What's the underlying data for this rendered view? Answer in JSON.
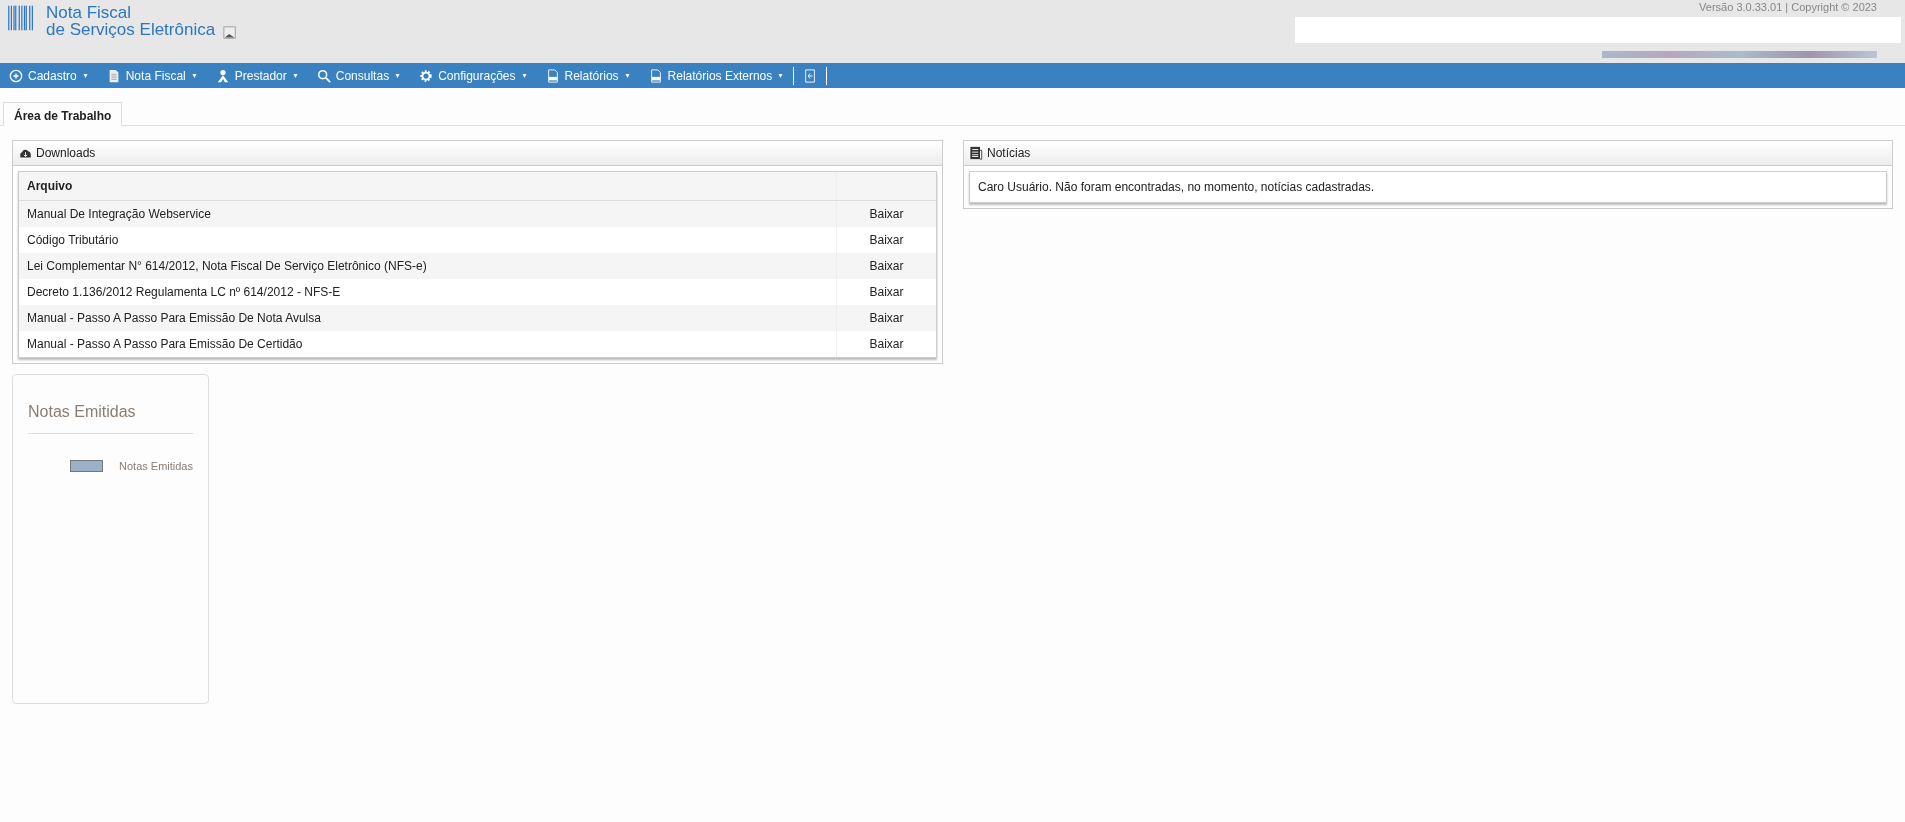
{
  "header": {
    "logo_line_1": "Nota Fiscal",
    "logo_line_2": "de Serviços Eletrônica",
    "version": "Versão 3.0.33.01 | Copyright © 2023"
  },
  "menu": [
    {
      "label": "Cadastro"
    },
    {
      "label": "Nota Fiscal"
    },
    {
      "label": "Prestador"
    },
    {
      "label": "Consultas"
    },
    {
      "label": "Configurações"
    },
    {
      "label": "Relatórios"
    },
    {
      "label": "Relatórios Externos"
    }
  ],
  "tabs": [
    {
      "label": "Área de Trabalho",
      "selected": true
    }
  ],
  "downloads": {
    "title": "Downloads",
    "columns": [
      "Arquivo"
    ],
    "rows": [
      {
        "file": "Manual De Integração Webservice",
        "action": "Baixar"
      },
      {
        "file": "Código Tributário",
        "action": "Baixar"
      },
      {
        "file": "Lei Complementar N° 614/2012, Nota Fiscal De Serviço Eletrônico (NFS-e)",
        "action": "Baixar"
      },
      {
        "file": "Decreto 1.136/2012 Regulamenta LC nº 614/2012 - NFS-E",
        "action": "Baixar"
      },
      {
        "file": "Manual - Passo A Passo Para Emissão De Nota Avulsa",
        "action": "Baixar"
      },
      {
        "file": "Manual - Passo A Passo Para Emissão De Certidão",
        "action": "Baixar"
      }
    ]
  },
  "news": {
    "title": "Notícias",
    "message": "Caro Usuário. Não foram encontradas, no momento, notícias cadastradas."
  },
  "chart_panel": {
    "title": "Notas Emitidas",
    "legend": [
      {
        "name": "Notas Emitidas",
        "color": "#9ab0c8"
      }
    ]
  }
}
